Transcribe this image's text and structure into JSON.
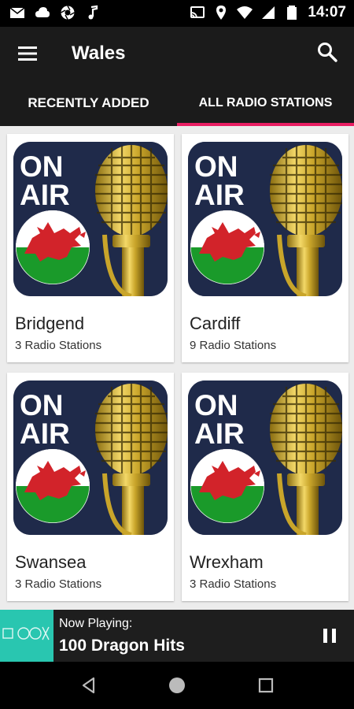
{
  "status_bar": {
    "time": "14:07",
    "left_icons": [
      "mail-icon",
      "cloud-icon",
      "aperture-icon",
      "music-note-icon"
    ],
    "right_icons": [
      "cast-icon",
      "location-icon",
      "wifi-icon",
      "signal-icon",
      "battery-icon"
    ]
  },
  "app_bar": {
    "title": "Wales",
    "menu_icon": "hamburger-menu-icon",
    "search_icon": "search-icon"
  },
  "tabs": [
    {
      "label": "RECENTLY ADDED",
      "selected": false
    },
    {
      "label": "ALL RADIO STATIONS",
      "selected": true
    }
  ],
  "accent_color": "#e91e63",
  "cards": [
    {
      "badge_line1": "ON",
      "badge_line2": "AIR",
      "name": "Bridgend",
      "count": "3 Radio Stations"
    },
    {
      "badge_line1": "ON",
      "badge_line2": "AIR",
      "name": "Cardiff",
      "count": "9 Radio Stations"
    },
    {
      "badge_line1": "ON",
      "badge_line2": "AIR",
      "name": "Swansea",
      "count": "3 Radio Stations"
    },
    {
      "badge_line1": "ON",
      "badge_line2": "AIR",
      "name": "Wrexham",
      "count": "3 Radio Stations"
    }
  ],
  "now_playing": {
    "label": "Now Playing:",
    "title": "100 Dragon Hits",
    "thumb_color": "#29c6b0",
    "control_icon": "pause-icon"
  },
  "nav_bar": {
    "icons": [
      "back-icon",
      "home-icon",
      "recents-icon"
    ]
  }
}
